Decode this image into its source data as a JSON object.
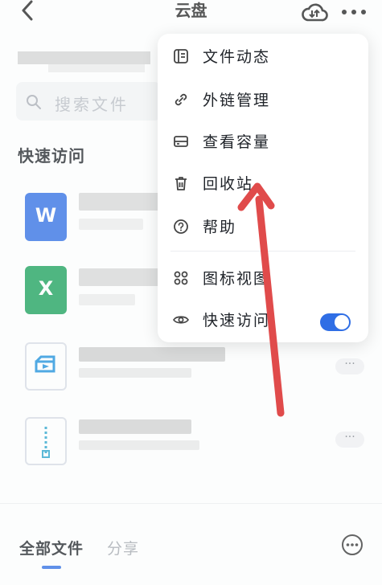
{
  "header": {
    "title": "云盘",
    "back_icon": "chevron-left-icon",
    "cloud_icon": "cloud-transfer-icon",
    "more_icon": "more-dots-icon"
  },
  "search": {
    "placeholder": "搜索文件"
  },
  "quick_access": {
    "title": "快速访问",
    "files": [
      {
        "type": "word",
        "icon_letter": "W",
        "color": "#2f6ee5"
      },
      {
        "type": "excel",
        "icon_letter": "X",
        "color": "#18a05a"
      },
      {
        "type": "presentation",
        "icon_letter": "",
        "color": "#1a8fdc"
      },
      {
        "type": "zip",
        "icon_letter": "",
        "color": "#2aa4cc"
      }
    ],
    "row_more_label": "···"
  },
  "menu": {
    "items": [
      {
        "label": "文件动态",
        "icon": "file-activity-icon"
      },
      {
        "label": "外链管理",
        "icon": "link-icon"
      },
      {
        "label": "查看容量",
        "icon": "storage-icon"
      },
      {
        "label": "回收站",
        "icon": "trash-icon"
      },
      {
        "label": "帮助",
        "icon": "help-icon"
      },
      {
        "label": "图标视图",
        "icon": "grid-view-icon"
      },
      {
        "label": "快速访问",
        "icon": "eye-icon",
        "toggle": true
      }
    ]
  },
  "bottom_tabs": {
    "all_files": "全部文件",
    "share": "分享"
  },
  "colors": {
    "accent": "#2f6ee5",
    "annotation_arrow": "#e04b4b"
  }
}
